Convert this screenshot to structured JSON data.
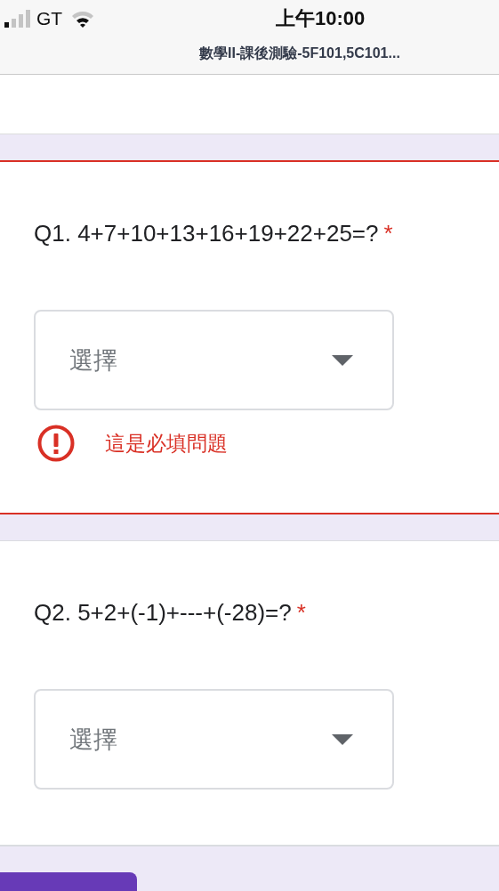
{
  "status_bar": {
    "carrier": "GT",
    "time": "上午10:00",
    "page_title": "數學II-課後測驗-5F101,5C101..."
  },
  "questions": [
    {
      "label": "Q1. 4+7+10+13+16+19+22+25=?",
      "required_mark": "*",
      "placeholder": "選擇",
      "error": true,
      "error_message": "這是必填問題"
    },
    {
      "label": "Q2. 5+2+(-1)+---+(-28)=?",
      "required_mark": "*",
      "placeholder": "選擇",
      "error": false
    }
  ]
}
